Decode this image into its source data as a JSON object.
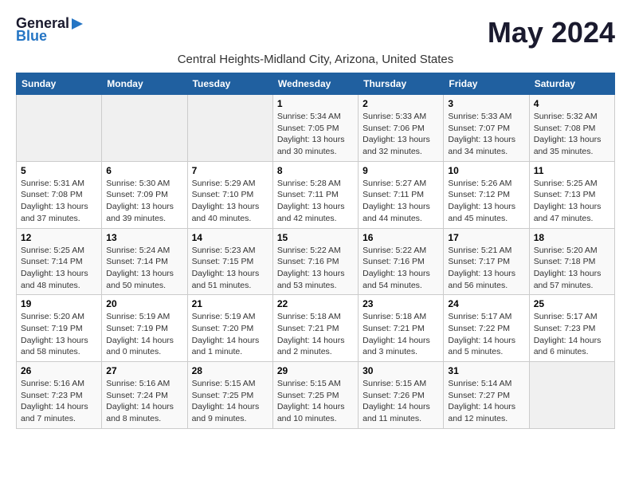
{
  "header": {
    "logo_general": "General",
    "logo_blue": "Blue",
    "month_title": "May 2024",
    "location": "Central Heights-Midland City, Arizona, United States"
  },
  "days_of_week": [
    "Sunday",
    "Monday",
    "Tuesday",
    "Wednesday",
    "Thursday",
    "Friday",
    "Saturday"
  ],
  "weeks": [
    [
      {
        "day": "",
        "info": ""
      },
      {
        "day": "",
        "info": ""
      },
      {
        "day": "",
        "info": ""
      },
      {
        "day": "1",
        "info": "Sunrise: 5:34 AM\nSunset: 7:05 PM\nDaylight: 13 hours\nand 30 minutes."
      },
      {
        "day": "2",
        "info": "Sunrise: 5:33 AM\nSunset: 7:06 PM\nDaylight: 13 hours\nand 32 minutes."
      },
      {
        "day": "3",
        "info": "Sunrise: 5:33 AM\nSunset: 7:07 PM\nDaylight: 13 hours\nand 34 minutes."
      },
      {
        "day": "4",
        "info": "Sunrise: 5:32 AM\nSunset: 7:08 PM\nDaylight: 13 hours\nand 35 minutes."
      }
    ],
    [
      {
        "day": "5",
        "info": "Sunrise: 5:31 AM\nSunset: 7:08 PM\nDaylight: 13 hours\nand 37 minutes."
      },
      {
        "day": "6",
        "info": "Sunrise: 5:30 AM\nSunset: 7:09 PM\nDaylight: 13 hours\nand 39 minutes."
      },
      {
        "day": "7",
        "info": "Sunrise: 5:29 AM\nSunset: 7:10 PM\nDaylight: 13 hours\nand 40 minutes."
      },
      {
        "day": "8",
        "info": "Sunrise: 5:28 AM\nSunset: 7:11 PM\nDaylight: 13 hours\nand 42 minutes."
      },
      {
        "day": "9",
        "info": "Sunrise: 5:27 AM\nSunset: 7:11 PM\nDaylight: 13 hours\nand 44 minutes."
      },
      {
        "day": "10",
        "info": "Sunrise: 5:26 AM\nSunset: 7:12 PM\nDaylight: 13 hours\nand 45 minutes."
      },
      {
        "day": "11",
        "info": "Sunrise: 5:25 AM\nSunset: 7:13 PM\nDaylight: 13 hours\nand 47 minutes."
      }
    ],
    [
      {
        "day": "12",
        "info": "Sunrise: 5:25 AM\nSunset: 7:14 PM\nDaylight: 13 hours\nand 48 minutes."
      },
      {
        "day": "13",
        "info": "Sunrise: 5:24 AM\nSunset: 7:14 PM\nDaylight: 13 hours\nand 50 minutes."
      },
      {
        "day": "14",
        "info": "Sunrise: 5:23 AM\nSunset: 7:15 PM\nDaylight: 13 hours\nand 51 minutes."
      },
      {
        "day": "15",
        "info": "Sunrise: 5:22 AM\nSunset: 7:16 PM\nDaylight: 13 hours\nand 53 minutes."
      },
      {
        "day": "16",
        "info": "Sunrise: 5:22 AM\nSunset: 7:16 PM\nDaylight: 13 hours\nand 54 minutes."
      },
      {
        "day": "17",
        "info": "Sunrise: 5:21 AM\nSunset: 7:17 PM\nDaylight: 13 hours\nand 56 minutes."
      },
      {
        "day": "18",
        "info": "Sunrise: 5:20 AM\nSunset: 7:18 PM\nDaylight: 13 hours\nand 57 minutes."
      }
    ],
    [
      {
        "day": "19",
        "info": "Sunrise: 5:20 AM\nSunset: 7:19 PM\nDaylight: 13 hours\nand 58 minutes."
      },
      {
        "day": "20",
        "info": "Sunrise: 5:19 AM\nSunset: 7:19 PM\nDaylight: 14 hours\nand 0 minutes."
      },
      {
        "day": "21",
        "info": "Sunrise: 5:19 AM\nSunset: 7:20 PM\nDaylight: 14 hours\nand 1 minute."
      },
      {
        "day": "22",
        "info": "Sunrise: 5:18 AM\nSunset: 7:21 PM\nDaylight: 14 hours\nand 2 minutes."
      },
      {
        "day": "23",
        "info": "Sunrise: 5:18 AM\nSunset: 7:21 PM\nDaylight: 14 hours\nand 3 minutes."
      },
      {
        "day": "24",
        "info": "Sunrise: 5:17 AM\nSunset: 7:22 PM\nDaylight: 14 hours\nand 5 minutes."
      },
      {
        "day": "25",
        "info": "Sunrise: 5:17 AM\nSunset: 7:23 PM\nDaylight: 14 hours\nand 6 minutes."
      }
    ],
    [
      {
        "day": "26",
        "info": "Sunrise: 5:16 AM\nSunset: 7:23 PM\nDaylight: 14 hours\nand 7 minutes."
      },
      {
        "day": "27",
        "info": "Sunrise: 5:16 AM\nSunset: 7:24 PM\nDaylight: 14 hours\nand 8 minutes."
      },
      {
        "day": "28",
        "info": "Sunrise: 5:15 AM\nSunset: 7:25 PM\nDaylight: 14 hours\nand 9 minutes."
      },
      {
        "day": "29",
        "info": "Sunrise: 5:15 AM\nSunset: 7:25 PM\nDaylight: 14 hours\nand 10 minutes."
      },
      {
        "day": "30",
        "info": "Sunrise: 5:15 AM\nSunset: 7:26 PM\nDaylight: 14 hours\nand 11 minutes."
      },
      {
        "day": "31",
        "info": "Sunrise: 5:14 AM\nSunset: 7:27 PM\nDaylight: 14 hours\nand 12 minutes."
      },
      {
        "day": "",
        "info": ""
      }
    ]
  ]
}
